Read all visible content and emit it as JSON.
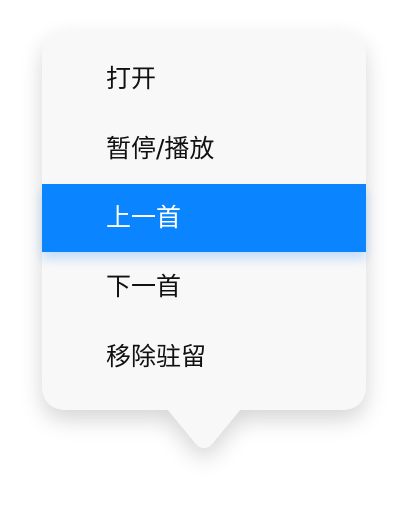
{
  "menu": {
    "items": [
      {
        "label": "打开",
        "selected": false
      },
      {
        "label": "暂停/播放",
        "selected": false
      },
      {
        "label": "上一首",
        "selected": true
      },
      {
        "label": "下一首",
        "selected": false
      },
      {
        "label": "移除驻留",
        "selected": false
      }
    ]
  },
  "colors": {
    "background": "#ffffff",
    "menu_background": "#f8f8f8",
    "highlight": "#0a84ff",
    "text": "#111111",
    "highlight_text": "#ffffff"
  }
}
